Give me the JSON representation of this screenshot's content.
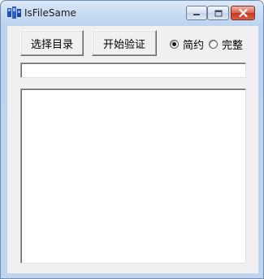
{
  "window": {
    "title": "IsFileSame",
    "app_icon": "application-icon",
    "caption_buttons": {
      "minimize_icon": "minimize-icon",
      "maximize_icon": "maximize-icon",
      "close_icon": "close-icon"
    },
    "colors": {
      "frame": "#bfd4ee",
      "client": "#f0f0f0",
      "close_button": "#c7381f"
    }
  },
  "toolbar": {
    "select_dir_label": "选择目录",
    "start_verify_label": "开始验证"
  },
  "mode": {
    "options": [
      {
        "label": "简约",
        "selected": true
      },
      {
        "label": "完整",
        "selected": false
      }
    ]
  },
  "path_field": {
    "value": ""
  },
  "output": {
    "text": ""
  }
}
